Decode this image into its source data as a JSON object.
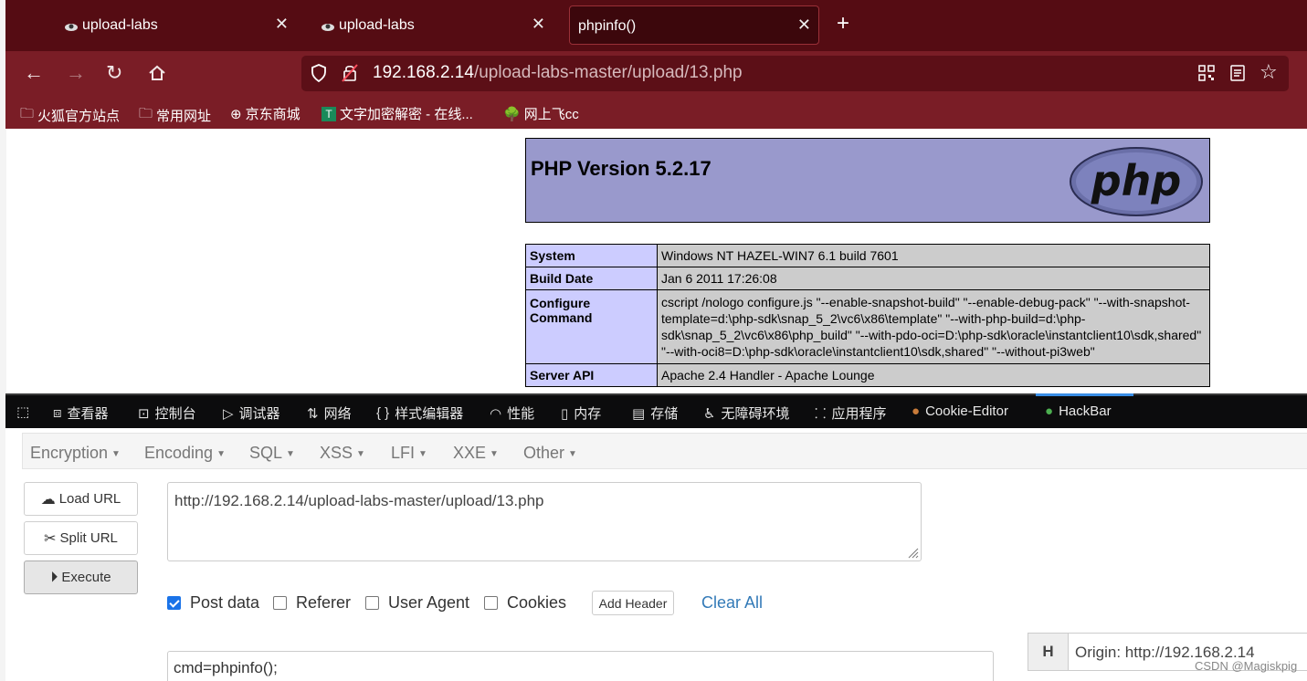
{
  "browser": {
    "tabs": [
      {
        "title": "upload-labs",
        "active": false
      },
      {
        "title": "upload-labs",
        "active": false
      },
      {
        "title": "phpinfo()",
        "active": true
      }
    ],
    "url_host": "192.168.2.14",
    "url_path": "/upload-labs-master/upload/13.php",
    "bookmarks": [
      "火狐官方站点",
      "常用网址",
      "京东商城",
      "文字加密解密 - 在线...",
      "网上飞cc"
    ]
  },
  "php": {
    "version": "PHP Version 5.2.17",
    "logo_text": "php",
    "rows": [
      {
        "key": "System",
        "value": "Windows NT HAZEL-WIN7 6.1 build 7601"
      },
      {
        "key": "Build Date",
        "value": "Jan 6 2011 17:26:08"
      },
      {
        "key": "Configure Command",
        "value": "cscript /nologo configure.js \"--enable-snapshot-build\" \"--enable-debug-pack\" \"--with-snapshot-template=d:\\php-sdk\\snap_5_2\\vc6\\x86\\template\" \"--with-php-build=d:\\php-sdk\\snap_5_2\\vc6\\x86\\php_build\" \"--with-pdo-oci=D:\\php-sdk\\oracle\\instantclient10\\sdk,shared\" \"--with-oci8=D:\\php-sdk\\oracle\\instantclient10\\sdk,shared\" \"--without-pi3web\""
      },
      {
        "key": "Server API",
        "value": "Apache 2.4 Handler - Apache Lounge"
      }
    ]
  },
  "devtools": {
    "tabs": [
      "查看器",
      "控制台",
      "调试器",
      "网络",
      "样式编辑器",
      "性能",
      "内存",
      "存储",
      "无障碍环境",
      "应用程序",
      "Cookie-Editor",
      "HackBar"
    ],
    "active": "HackBar"
  },
  "hackbar": {
    "menus": [
      "Encryption",
      "Encoding",
      "SQL",
      "XSS",
      "LFI",
      "XXE",
      "Other"
    ],
    "buttons": {
      "load": "Load URL",
      "split": "Split URL",
      "execute": "Execute"
    },
    "url_value": "http://192.168.2.14/upload-labs-master/upload/13.php",
    "options": [
      {
        "label": "Post data",
        "checked": true
      },
      {
        "label": "Referer",
        "checked": false
      },
      {
        "label": "User Agent",
        "checked": false
      },
      {
        "label": "Cookies",
        "checked": false
      }
    ],
    "add_header": "Add Header",
    "clear_all": "Clear All",
    "post_value": "cmd=phpinfo();",
    "header_key": "H",
    "header_value": "Origin: http://192.168.2.14"
  },
  "watermark": "CSDN @Magiskpig"
}
